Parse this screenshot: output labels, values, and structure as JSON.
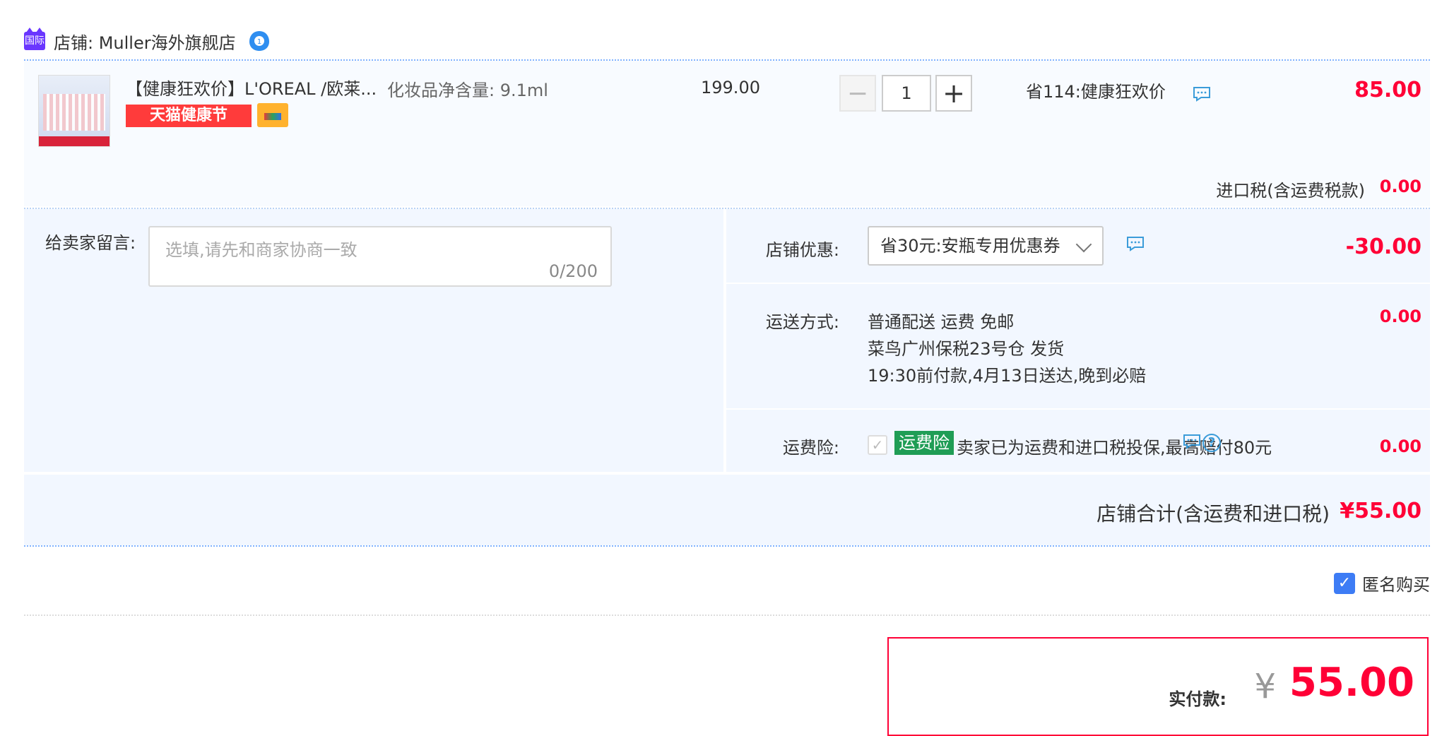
{
  "shop": {
    "badge": "国际",
    "name": "店铺: Muller海外旗舰店"
  },
  "product": {
    "title": "【健康狂欢价】L'OREAL /欧莱...",
    "spec": "化妆品净含量: 9.1ml",
    "tag": "天猫健康节",
    "unit_price": "199.00",
    "quantity": "1",
    "qty_minus": "−",
    "qty_plus": "+",
    "promo": "省114:健康狂欢价",
    "total": "85.00"
  },
  "tax": {
    "label": "进口税(含运费税款)",
    "value": "0.00"
  },
  "message": {
    "label": "给卖家留言:",
    "placeholder": "选填,请先和商家协商一致",
    "count": "0/200"
  },
  "coupon": {
    "label": "店铺优惠:",
    "selected": "省30元:安瓶专用优惠券",
    "value": "-30.00"
  },
  "shipping": {
    "label": "运送方式:",
    "line1": "普通配送 运费 免邮",
    "line2": "菜鸟广州保税23号仓  发货",
    "line3": "19:30前付款,4月13日送达,晚到必赔",
    "value": "0.00"
  },
  "insurance": {
    "label": "运费险:",
    "check": "✓",
    "badge": "运费险",
    "desc": "卖家已为运费和进口税投保,最高赔付80元",
    "help": "?",
    "value": "0.00"
  },
  "shop_total": {
    "label": "店铺合计(含运费和进口税)",
    "value": "¥55.00"
  },
  "anonymous": {
    "check": "✓",
    "label": "匿名购买"
  },
  "payment": {
    "label": "实付款:",
    "currency": "¥",
    "value": "55.00"
  },
  "colors": {
    "accent_red": "#ff0036",
    "panel_bg": "#f2f7ff",
    "insurance_green": "#1f9d55",
    "checkbox_blue": "#3d7cf5"
  }
}
